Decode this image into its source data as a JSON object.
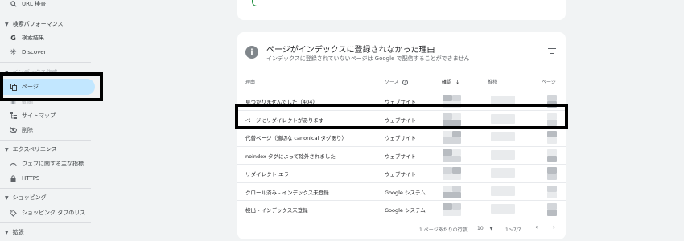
{
  "sidebar": {
    "url_inspection": "URL 検査",
    "search_performance_section": "検索パフォーマンス",
    "search_results": "検索結果",
    "discover": "Discover",
    "indexing_section": "インデックス作成",
    "pages": "ページ",
    "sitemaps_hidden": "動画",
    "sitemaps": "サイトマップ",
    "removals": "削除",
    "experience_section": "エクスペリエンス",
    "core_web_vitals": "ウェブに関する主な指標",
    "https": "HTTPS",
    "shopping_section": "ショッピング",
    "shopping_tab": "ショッピング タブのリス...",
    "enhancements_section": "拡張"
  },
  "card": {
    "title": "ページがインデックスに登録されなかった理由",
    "subtitle": "インデックスに登録されていないページは Google で配信することができません"
  },
  "table": {
    "headers": {
      "reason": "理由",
      "source": "ソース",
      "validation": "確認",
      "trend": "推移",
      "pages": "ページ"
    },
    "rows": [
      {
        "reason": "見つかりませんでした（404）",
        "source": "ウェブサイト"
      },
      {
        "reason": "ページにリダイレクトがあります",
        "source": "ウェブサイト"
      },
      {
        "reason": "代替ページ（適切な canonical タグあり）",
        "source": "ウェブサイト"
      },
      {
        "reason": "noindex タグによって除外されました",
        "source": "ウェブサイト"
      },
      {
        "reason": "リダイレクト エラー",
        "source": "ウェブサイト"
      },
      {
        "reason": "クロール済み - インデックス未登録",
        "source": "Google システム"
      },
      {
        "reason": "検出 - インデックス未登録",
        "source": "Google システム"
      }
    ]
  },
  "pagination": {
    "rows_per_page_label": "1 ページあたりの行数:",
    "rows_per_page_value": "10",
    "range": "1～7/7"
  }
}
